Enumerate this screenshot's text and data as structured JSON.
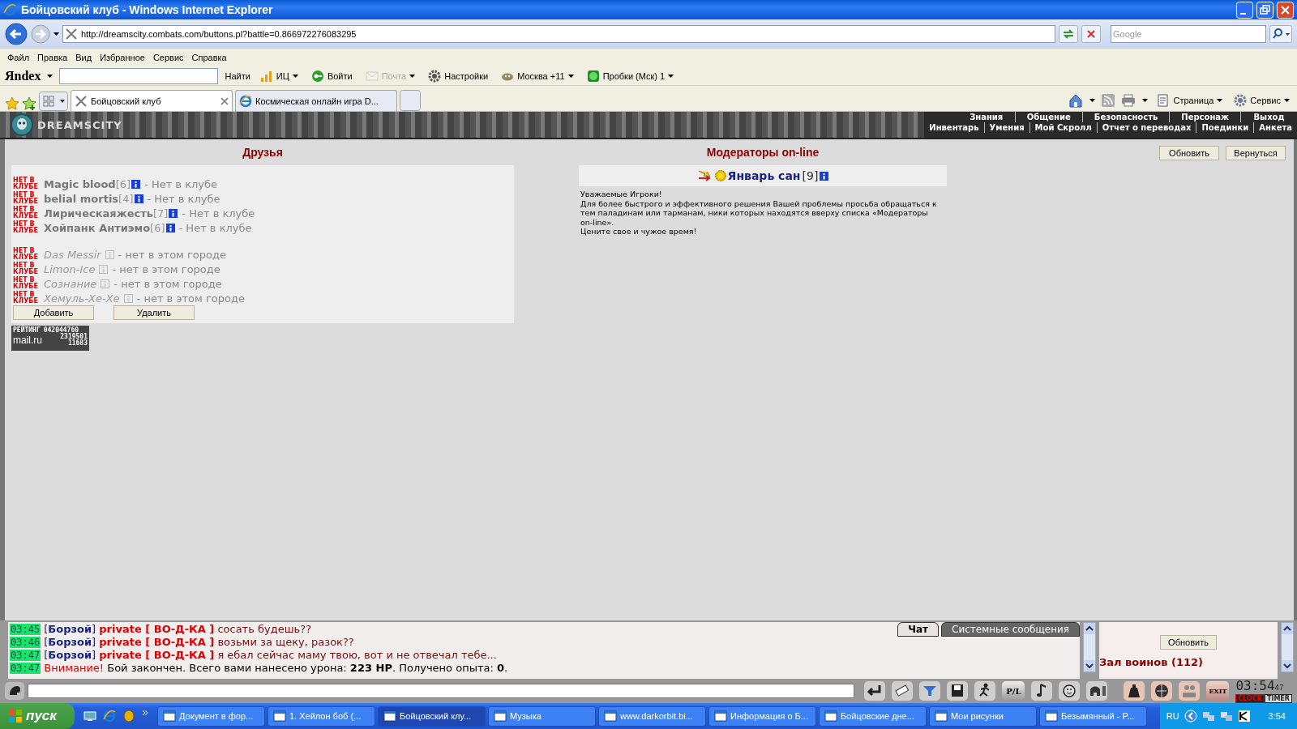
{
  "window": {
    "title": "Бойцовский клуб - Windows Internet Explorer"
  },
  "address_bar": {
    "url": "http://dreamscity.combats.com/buttons.pl?battle=0.866972276083295",
    "search_placeholder": "Google"
  },
  "menu": [
    "Файл",
    "Правка",
    "Вид",
    "Избранное",
    "Сервис",
    "Справка"
  ],
  "yandex_toolbar": {
    "logo": "Яndex",
    "search_button": "Найти",
    "items": [
      {
        "label": "ИЦ",
        "kind": "bars",
        "disabled": false
      },
      {
        "label": "Войти",
        "kind": "key",
        "disabled": false
      },
      {
        "label": "Почта",
        "kind": "mail",
        "disabled": true
      },
      {
        "label": "Настройки",
        "kind": "gear",
        "disabled": false
      },
      {
        "label": "Москва +11",
        "kind": "weather",
        "disabled": false
      },
      {
        "label": "Пробки (Мск) 1",
        "kind": "traffic",
        "disabled": false
      }
    ]
  },
  "tabs": [
    {
      "label": "Бойцовский клуб",
      "selected": true
    },
    {
      "label": "Космическая онлайн игра D...",
      "selected": false
    }
  ],
  "command_bar": [
    "Страница",
    "Сервис"
  ],
  "game": {
    "logo": "DREAMSCITY",
    "nav_top": [
      "Знания",
      "Общение",
      "Безопасность",
      "Персонаж",
      "Выход"
    ],
    "nav_bottom": [
      "Инвентарь",
      "Умения",
      "Мой Скролл",
      "Отчет о переводах",
      "Поединки",
      "Анкета"
    ]
  },
  "friends": {
    "title": "Друзья",
    "entries": [
      {
        "kind": "club",
        "badge": "НЕТ В КЛУБЕ",
        "name": "Magic blood",
        "level": "[6]",
        "status": "- Нет в клубе"
      },
      {
        "kind": "club",
        "badge": "НЕТ В КЛУБЕ",
        "name": "belial mortis",
        "level": "[4]",
        "status": "- Нет в клубе"
      },
      {
        "kind": "club",
        "badge": "НЕТ В КЛУБЕ",
        "name": "Лирическаяжесть",
        "level": "[7]",
        "status": "- Нет в клубе"
      },
      {
        "kind": "club",
        "badge": "НЕТ В КЛУБЕ",
        "name": "Хойпанк Антиэмо",
        "level": "[6]",
        "status": "- Нет в клубе"
      },
      {
        "kind": "city",
        "badge": "НЕТ В КЛУБЕ",
        "name": "Das Messir",
        "status": "- нет в этом городе"
      },
      {
        "kind": "city",
        "badge": "НЕТ В КЛУБЕ",
        "name": "Limon-Ice",
        "status": "- нет в этом городе"
      },
      {
        "kind": "city",
        "badge": "НЕТ В КЛУБЕ",
        "name": "Сознание",
        "status": "- нет в этом городе"
      },
      {
        "kind": "city",
        "badge": "НЕТ В КЛУБЕ",
        "name": "Хемуль-Хе-Хе",
        "status": "- нет в этом городе"
      }
    ],
    "buttons": [
      "Добавить",
      "Удалить"
    ]
  },
  "counter": {
    "title": "РЕЙТИНГ",
    "number": "042044760",
    "logo": "mail.ru",
    "hits": "2319501",
    "hosts": "11683"
  },
  "moderators": {
    "title": "Модераторы on-line",
    "list": [
      {
        "name": "Январь сан",
        "level": "[9]"
      }
    ],
    "notice": [
      "Уважаемые Игроки!",
      "Для более быстрого и эффективного решения Вашей проблемы просьба обращаться к тем паладинам или тарманам, ники которых находятся вверху списка «Модераторы on-line».",
      "Цените свое и чужое время!"
    ]
  },
  "page_buttons": [
    "Обновить",
    "Вернуться"
  ],
  "chat": {
    "messages": [
      {
        "kind": "private",
        "time": "03:45",
        "sender": "[**Борзой**]",
        "target": "private [ ВО-Д-КА ]",
        "text": "сосать будешь??"
      },
      {
        "kind": "private",
        "time": "03:46",
        "sender": "[**Борзой**]",
        "target": "private [ ВО-Д-КА ]",
        "text": "возьми за щеку, разок??"
      },
      {
        "kind": "private",
        "time": "03:47",
        "sender": "[**Борзой**]",
        "target": "private [ ВО-Д-КА ]",
        "text": "я ебал сейчас маму твою, вот и не отвечал тебе..."
      },
      {
        "kind": "system",
        "time": "03:47",
        "alert": "Внимание!",
        "text": "Бой закончен. Всего вами нанесено урона: **223 HP**. Получено опыта: **0**."
      }
    ],
    "tabs": [
      {
        "label": "Чат",
        "selected": true
      },
      {
        "label": "Системные сообщения",
        "selected": false
      }
    ],
    "side": {
      "button": "Обновить",
      "room": "Зал воинов (112)"
    },
    "toolbar": {
      "translit": "P/L",
      "exit": "EXIT"
    },
    "clock": {
      "time": "03:54",
      "seconds": "47",
      "clock_label": "CLOCK",
      "timer_label": "TIMER"
    }
  },
  "taskbar": {
    "start": "пуск",
    "tasks": [
      {
        "label": "Документ в фор...",
        "selected": false
      },
      {
        "label": "1. Хейлон боб (...",
        "selected": false
      },
      {
        "label": "Бойцовский клу...",
        "selected": true
      },
      {
        "label": "Музыка",
        "selected": false
      },
      {
        "label": "www.darkorbit.bi...",
        "selected": false
      },
      {
        "label": "Информация о Б...",
        "selected": false
      },
      {
        "label": "Бойцовские дне...",
        "selected": false
      },
      {
        "label": "Мои рисунки",
        "selected": false
      },
      {
        "label": "Безымянный - P...",
        "selected": false
      }
    ],
    "language": "RU",
    "time": "3:54"
  }
}
